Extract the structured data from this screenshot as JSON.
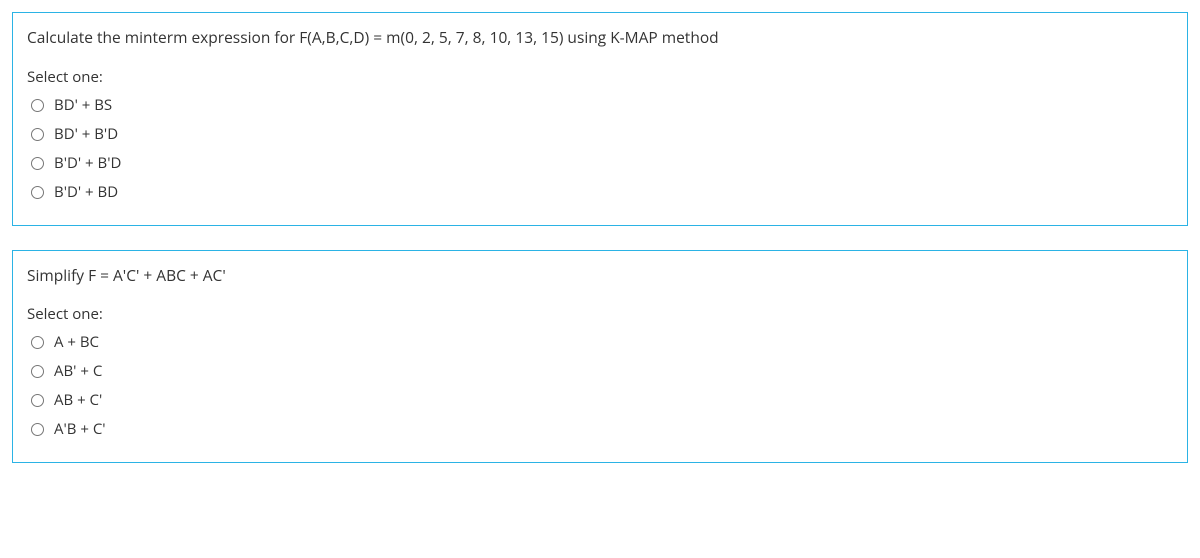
{
  "questions": [
    {
      "prompt": "Calculate the minterm expression for F(A,B,C,D) = m(0, 2, 5, 7, 8, 10, 13, 15)  using K-MAP method",
      "select_label": "Select one:",
      "options": [
        "BD' + BS",
        "BD' + B'D",
        "B'D' + B'D",
        "B'D' + BD"
      ]
    },
    {
      "prompt": "Simplify F = A'C' + ABC + AC'",
      "select_label": "Select one:",
      "options": [
        "A + BC",
        "AB' + C",
        "AB + C'",
        "A'B + C'"
      ]
    }
  ]
}
